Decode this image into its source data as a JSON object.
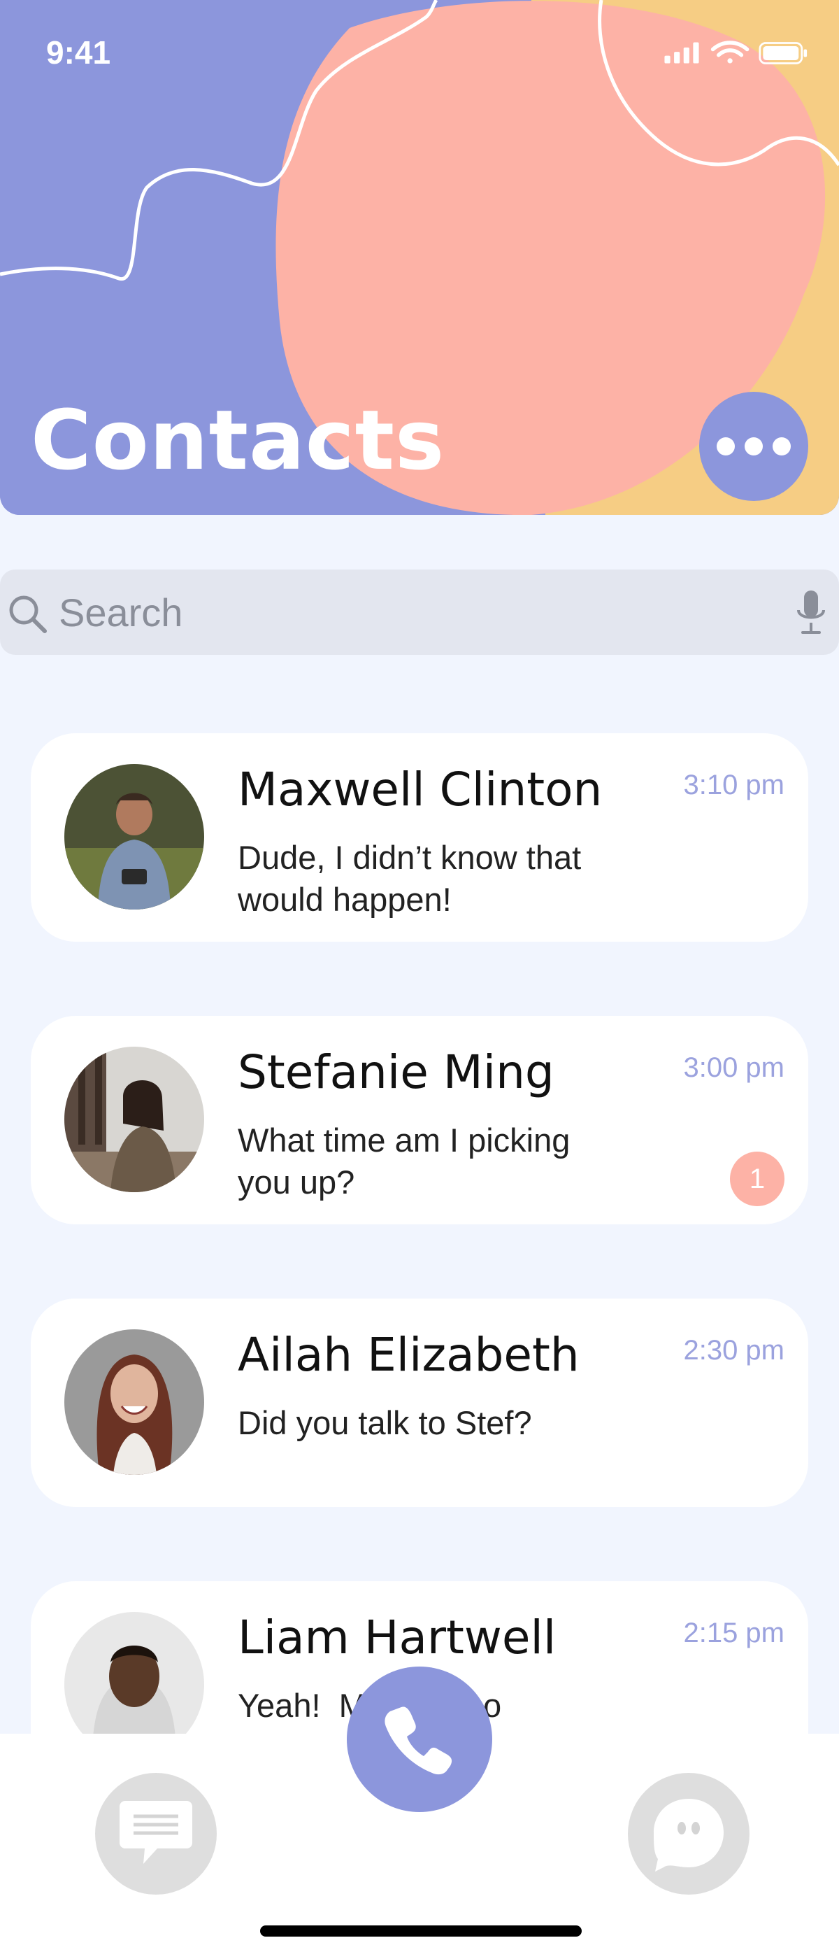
{
  "status_bar": {
    "time": "9:41"
  },
  "header": {
    "title": "Contacts"
  },
  "search": {
    "placeholder": "Search"
  },
  "contacts": [
    {
      "name": "Maxwell Clinton",
      "message": "Dude, I didn’t know that would happen!",
      "time": "3:10 pm"
    },
    {
      "name": "Stefanie Ming",
      "message": "What time am I picking you up?",
      "time": "3:00 pm",
      "unread": "1"
    },
    {
      "name": "Ailah Elizabeth",
      "message": "Did you talk to Stef?",
      "time": "2:30 pm"
    },
    {
      "name": "Liam Hartwell",
      "message": "Yeah!  M     soooo",
      "time": "2:15 pm"
    }
  ],
  "icons": {
    "more": "more-dots-icon",
    "search": "search-icon",
    "mic": "microphone-icon",
    "tab_messages": "message-bubble-icon",
    "tab_chat": "chat-bubble-icon",
    "call": "phone-icon"
  },
  "colors": {
    "periwinkle": "#8c96dc",
    "peach": "#fdb2a6",
    "yellow": "#f6cd84",
    "background": "#f1f5fe",
    "time_text": "#9ba2de"
  }
}
